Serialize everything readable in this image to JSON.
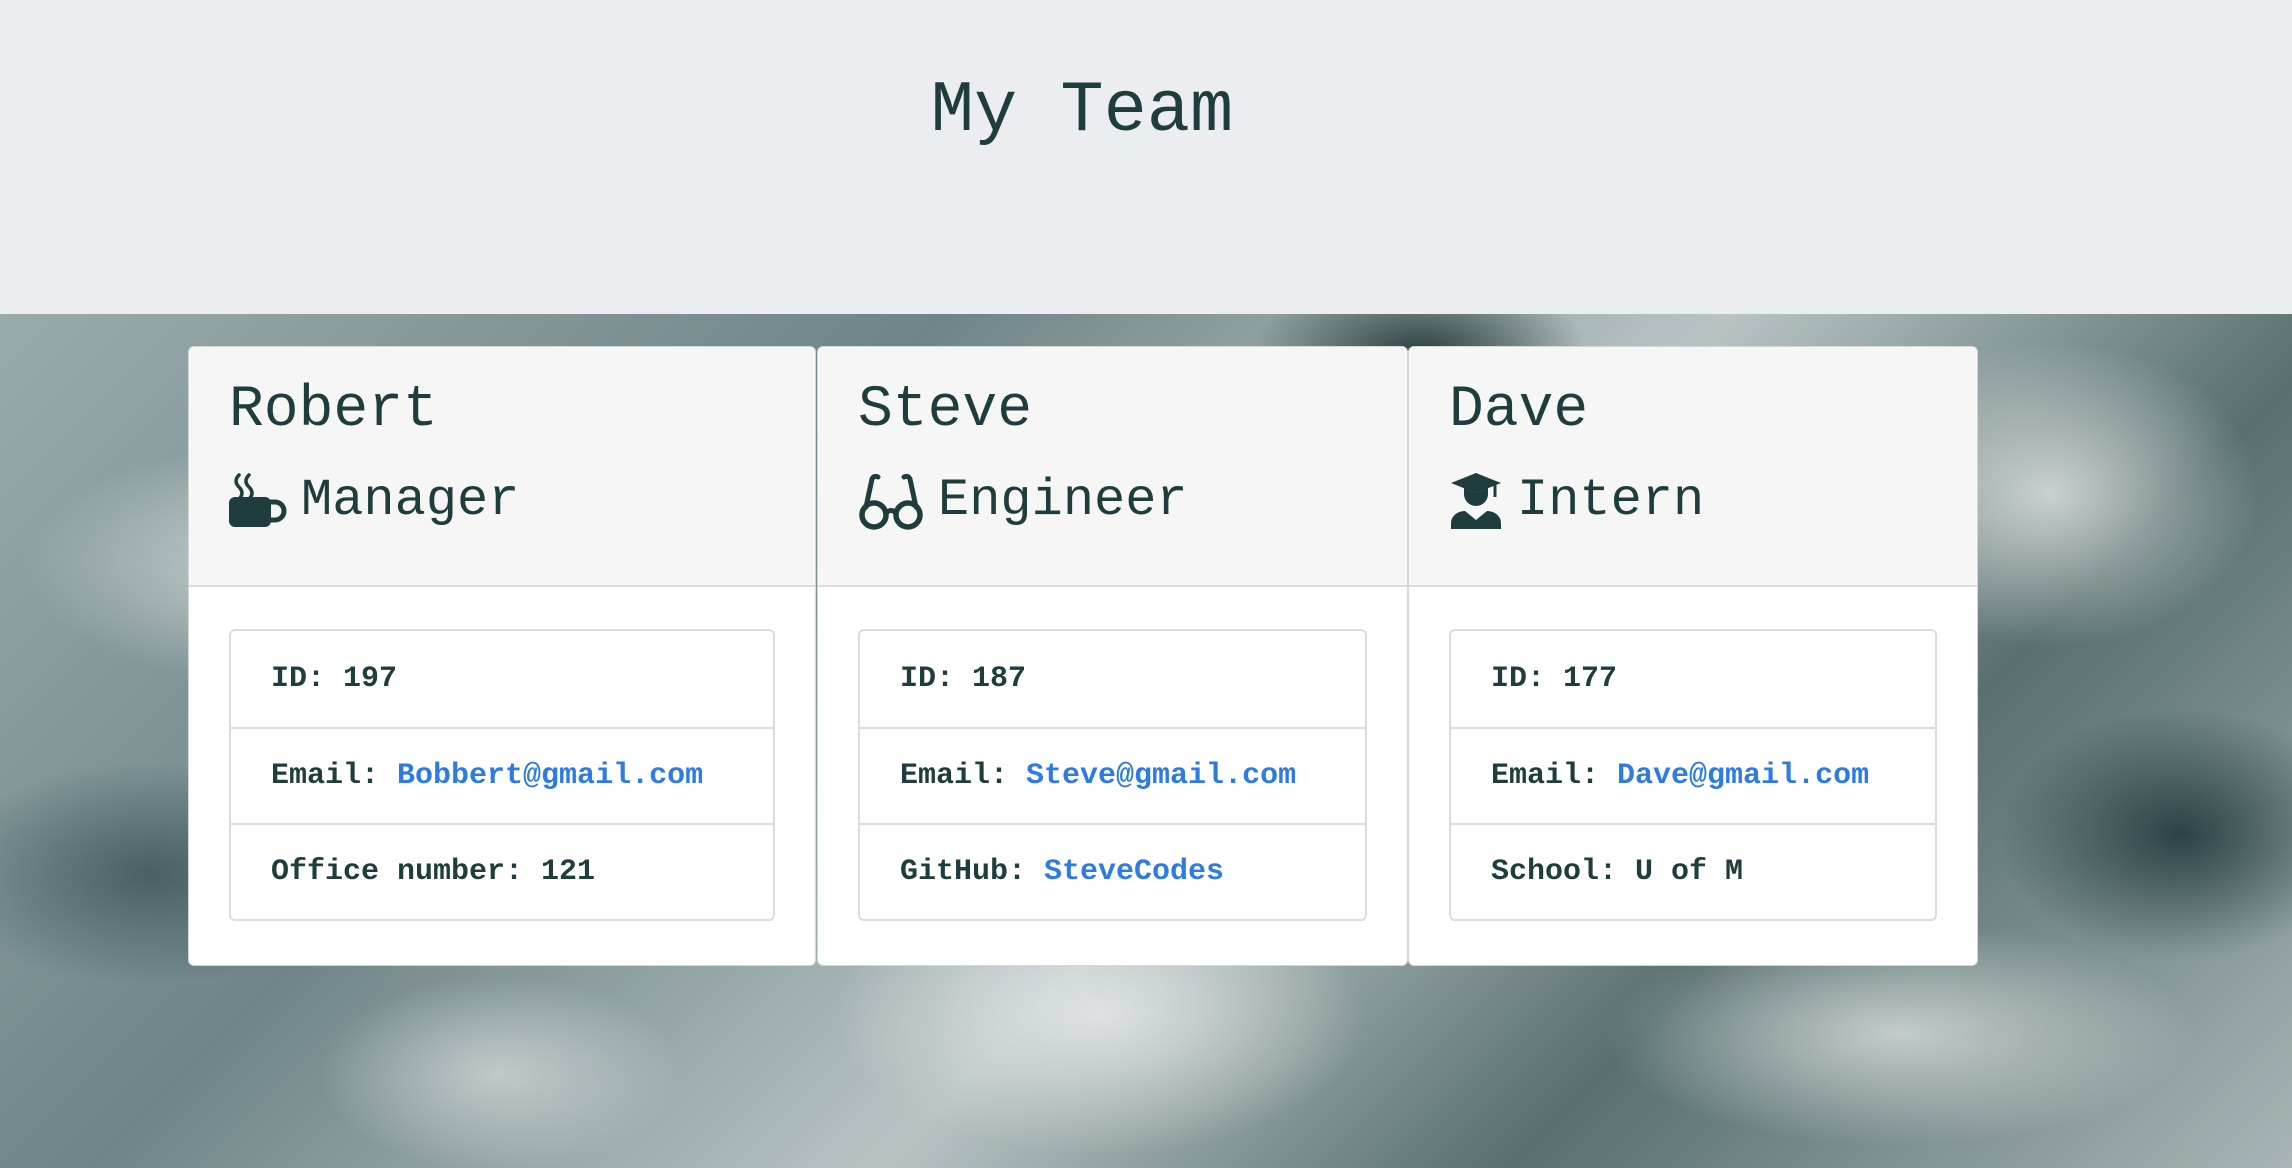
{
  "header": {
    "title": "My Team"
  },
  "cards": [
    {
      "name": "Robert",
      "role": "Manager",
      "role_icon": "coffee-mug-icon",
      "id_label": "ID:",
      "id_value": "197",
      "email_label": "Email:",
      "email_value": "Bobbert@gmail.com",
      "extra_label": "Office number:",
      "extra_value": "121"
    },
    {
      "name": "Steve",
      "role": "Engineer",
      "role_icon": "glasses-icon",
      "id_label": "ID:",
      "id_value": "187",
      "email_label": "Email:",
      "email_value": "Steve@gmail.com",
      "extra_label": "GitHub:",
      "extra_value": "SteveCodes"
    },
    {
      "name": "Dave",
      "role": "Intern",
      "role_icon": "graduate-icon",
      "id_label": "ID:",
      "id_value": "177",
      "email_label": "Email:",
      "email_value": "Dave@gmail.com",
      "extra_label": "School:",
      "extra_value": "U of M"
    }
  ],
  "colors": {
    "text": "#1f3d3d",
    "link": "#2d7be5",
    "header_bg": "#ebedf0",
    "card_head_bg": "#f6f6f6"
  }
}
